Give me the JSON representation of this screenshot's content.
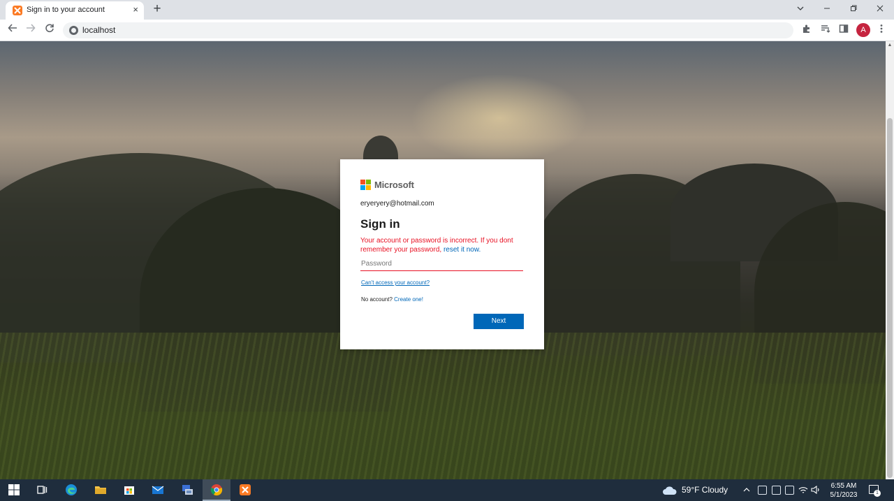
{
  "browser": {
    "tab_title": "Sign in to your account",
    "new_tab_symbol": "+",
    "tab_close_symbol": "×",
    "url": "localhost",
    "profile_initial": "A",
    "profile_color": "#c5243f",
    "favicon_color": "#fb7a24"
  },
  "signin": {
    "brand": "Microsoft",
    "brand_colors": [
      "#f25022",
      "#7fba00",
      "#00a4ef",
      "#ffb900"
    ],
    "email": "eryeryery@hotmail.com",
    "heading": "Sign in",
    "error_text": "Your account or password is incorrect. If you dont remember your password,",
    "error_link": "reset it now.",
    "password_placeholder": "Password",
    "cant_access_link": "Can't access your account?",
    "no_account_text": "No account?",
    "create_link": "Create one!",
    "next_button": "Next",
    "accent_color": "#0067b8",
    "error_color": "#e81123"
  },
  "taskbar": {
    "weather": "59°F  Cloudy",
    "time": "6:55 AM",
    "date": "5/1/2023",
    "notification_count": "1",
    "apps": [
      "windows-start",
      "task-view",
      "edge",
      "file-explorer",
      "microsoft-store",
      "mail",
      "network-app",
      "chrome",
      "xampp"
    ]
  }
}
